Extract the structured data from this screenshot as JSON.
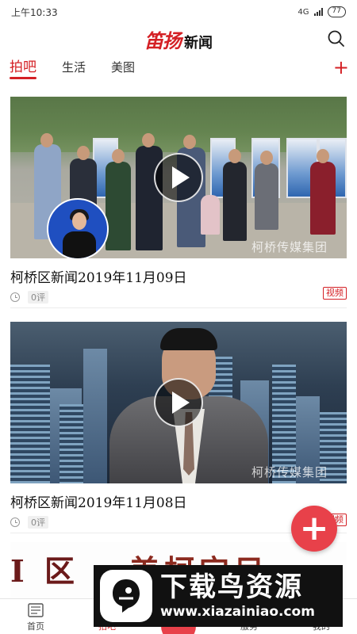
{
  "status_bar": {
    "time": "上午10:33",
    "network": "4G",
    "battery": "77"
  },
  "header": {
    "logo_brand": "笛扬",
    "logo_text": "新闻"
  },
  "tabs": [
    {
      "label": "拍吧",
      "active": true
    },
    {
      "label": "生活",
      "active": false
    },
    {
      "label": "美图",
      "active": false
    }
  ],
  "tabs_add_label": "+",
  "feed": [
    {
      "title": "柯桥区新闻2019年11月09日",
      "comments": "0评",
      "tag": "视频",
      "watermark": "柯桥传媒集团"
    },
    {
      "title": "柯桥区新闻2019年11月08日",
      "comments": "0评",
      "tag": "视频",
      "watermark": "柯桥传媒集团"
    }
  ],
  "partial_card": {
    "text_left": "I 区",
    "text_right": "美柯宝目"
  },
  "fab_label": "+",
  "bottom_nav": [
    {
      "label": "首页",
      "icon": "newspaper-icon",
      "active": false
    },
    {
      "label": "拍吧",
      "icon": "camera-icon",
      "active": true
    },
    {
      "label": "服务",
      "icon": "grid-icon",
      "active": false
    },
    {
      "label": "我的",
      "icon": "user-icon",
      "active": false
    }
  ],
  "ad_banner": {
    "title": "下载鸟资源",
    "url": "www.xiazainiao.com"
  },
  "colors": {
    "accent": "#d42025",
    "fab": "#e8414a"
  }
}
